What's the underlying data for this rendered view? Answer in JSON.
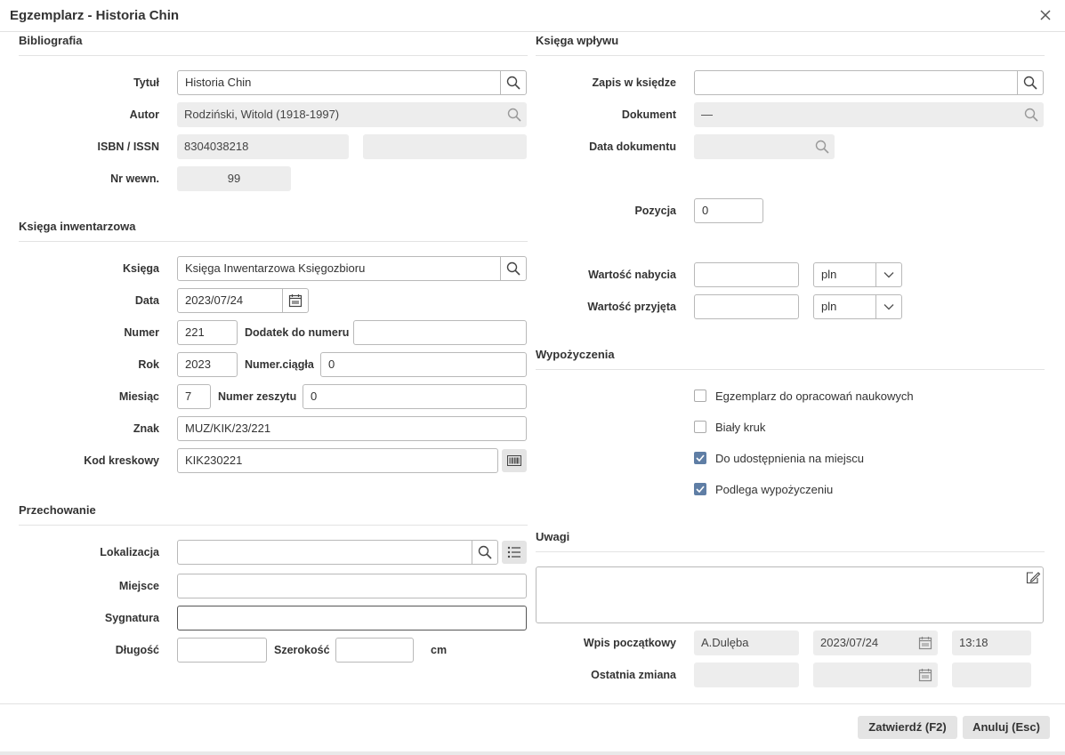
{
  "window": {
    "title": "Egzemplarz - Historia Chin"
  },
  "bibliografia": {
    "header": "Bibliografia",
    "tytul_label": "Tytuł",
    "tytul": "Historia Chin",
    "autor_label": "Autor",
    "autor": "Rodziński, Witold (1918-1997)",
    "isbn_label": "ISBN / ISSN",
    "isbn": "8304038218",
    "issn": "",
    "nr_label": "Nr wewn.",
    "nr": "99"
  },
  "inwentarz": {
    "header": "Księga inwentarzowa",
    "ksiega_label": "Księga",
    "ksiega": "Księga Inwentarzowa Księgozbioru",
    "data_label": "Data",
    "data": "2023/07/24",
    "numer_label": "Numer",
    "numer": "221",
    "dodatek_label": "Dodatek do numeru",
    "dodatek": "",
    "rok_label": "Rok",
    "rok": "2023",
    "ciagla_label": "Numer.ciągła",
    "ciagla": "0",
    "miesiac_label": "Miesiąc",
    "miesiac": "7",
    "zeszyt_label": "Numer zeszytu",
    "zeszyt": "0",
    "znak_label": "Znak",
    "znak": "MUZ/KIK/23/221",
    "kod_label": "Kod kreskowy",
    "kod": "KIK230221"
  },
  "przechowanie": {
    "header": "Przechowanie",
    "lokalizacja_label": "Lokalizacja",
    "lokalizacja": "",
    "miejsce_label": "Miejsce",
    "miejsce": "",
    "sygnatura_label": "Sygnatura",
    "sygnatura": "",
    "dlugosc_label": "Długość",
    "dlugosc": "",
    "szerokosc_label": "Szerokość",
    "szerokosc": "",
    "unit": "cm"
  },
  "wplyw": {
    "header": "Księga wpływu",
    "zapis_label": "Zapis w księdze",
    "zapis": "",
    "dokument_label": "Dokument",
    "dokument": "—",
    "data_dok_label": "Data dokumentu",
    "data_dok": "",
    "pozycja_label": "Pozycja",
    "pozycja": "0",
    "nabycia_label": "Wartość nabycia",
    "nabycia": "",
    "nabycia_cur": "pln",
    "przyjeta_label": "Wartość przyjęta",
    "przyjeta": "",
    "przyjeta_cur": "pln"
  },
  "wypozyczenia": {
    "header": "Wypożyczenia",
    "items": [
      {
        "label": "Egzemplarz do opracowań naukowych",
        "checked": false
      },
      {
        "label": "Biały kruk",
        "checked": false
      },
      {
        "label": "Do udostępnienia na miejscu",
        "checked": true
      },
      {
        "label": "Podlega wypożyczeniu",
        "checked": true
      }
    ]
  },
  "uwagi": {
    "header": "Uwagi",
    "text": "",
    "wpis_label": "Wpis początkowy",
    "wpis_user": "A.Dulęba",
    "wpis_date": "2023/07/24",
    "wpis_time": "13:18",
    "zmiana_label": "Ostatnia zmiana",
    "zmiana_user": "",
    "zmiana_date": "",
    "zmiana_time": ""
  },
  "footer": {
    "confirm": "Zatwierdź (F2)",
    "cancel": "Anuluj (Esc)"
  },
  "colors": {
    "accent": "#5f7ea5",
    "readonly_bg": "#ededed",
    "button_bg": "#e4e4e4"
  }
}
